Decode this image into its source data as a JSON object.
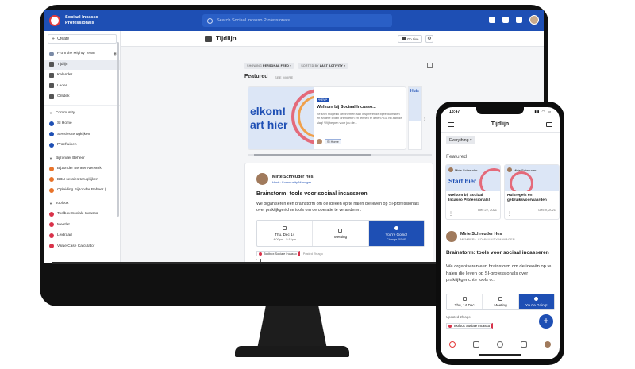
{
  "desktop": {
    "brand": "Sociaal Incasso Professionals",
    "search_placeholder": "Search Sociaal Incasso Professionals",
    "sidebar": {
      "create_label": "Create",
      "top_items": [
        {
          "label": "From the Mighty Team"
        },
        {
          "label": "Tijdlijn"
        },
        {
          "label": "Kalender"
        },
        {
          "label": "Leden"
        },
        {
          "label": "Ontdek"
        }
      ],
      "sections": [
        {
          "title": "Community",
          "items": [
            "SI Home",
            "Sessies terugkijken",
            "Proeftuinen"
          ]
        },
        {
          "title": "Bijzonder Beheer",
          "items": [
            "Bijzonder Beheer Netwerk",
            "BBN sessies terugkijken",
            "Opleiding Bijzonder Beheer (..."
          ]
        },
        {
          "title": "Toolbox",
          "items": [
            "Toolbox Sociale Incasso",
            "Meetlat",
            "Leidraad",
            "Value Case Calculator"
          ]
        }
      ]
    },
    "page_title": "Tijdlijn",
    "go_live_label": "Go Live",
    "filters": {
      "showing_prefix": "SHOWING",
      "showing_value": "PERSONAL FEED",
      "sorted_prefix": "SORTED BY",
      "sorted_value": "LAST ACTIVITY"
    },
    "featured_label": "Featured",
    "see_more_label": "SEE MORE",
    "featured_card": {
      "image_text_1": "elkom!",
      "image_text_2": "art hier",
      "badge": "*NEW*",
      "title": "Welkom bij Sociaal Incasso...",
      "description": "Ze snel mogelijk deelnemen aan inspirerende bijeenkomsten en andere leden ontmoeten en lennen te delen? Ga nu aan de slag! Wij helpen voor jou de...",
      "tag": "SI Home"
    },
    "featured_card_2_text": "Huis",
    "post": {
      "author": "Mirte Schreuder Hes",
      "role": "Host · Community Manager",
      "title": "Brainstorm: tools voor sociaal incasseren",
      "body": "We organiseren een brainstorm om de ideeën op te halen die leven op SI-professionals over praktijkgerichte tools om de operatie te veranderen.",
      "date_label": "Thu, Dec 14",
      "time_label": "4:00pm - 5:15pm",
      "type_label": "Meeting",
      "rsvp_label": "You're Going!",
      "rsvp_sub": "Change RSVP",
      "tag": "Toolbox Sociale Incasso",
      "posted": "Posted 2h ago"
    }
  },
  "mobile": {
    "time": "13:47",
    "title": "Tijdlijn",
    "filter": "Everything",
    "featured_label": "Featured",
    "cards": [
      {
        "who": "Mirte Schreuder...",
        "image_text": "Start hier",
        "title": "Welkom bij Sociaal Incasso Professionals!",
        "date": "Dec 22, 2021"
      },
      {
        "who": "Mirte Schreuder...",
        "image_text": "",
        "title": "Huisregels en gebruiksvoorwaarden",
        "date": "Dec 9, 2021"
      }
    ],
    "post": {
      "author": "Mirte Schreuder Hes",
      "role": "MEMBER · COMMUNITY MANAGER",
      "title": "Brainstorm: tools voor sociaal incasseren",
      "body": "We organiseren een brainstorm om de ideeën op te halen die leven op SI-professionals over praktijkgerichte tools o...",
      "date_label": "Thu, 14 Dec",
      "type_label": "Meeting",
      "rsvp_label": "You're Going!",
      "updated": "Updated 2h ago",
      "tag": "Toolbox Sociale Incasso"
    },
    "fab": "+"
  },
  "colors": {
    "brand_blue": "#1e4fb4",
    "accent_red": "#d9324a"
  },
  "icons": [
    "search-icon",
    "add-user-icon",
    "chat-icon",
    "bell-icon",
    "camera-icon",
    "gear-icon",
    "grid-icon",
    "menu-icon",
    "comment-icon"
  ]
}
